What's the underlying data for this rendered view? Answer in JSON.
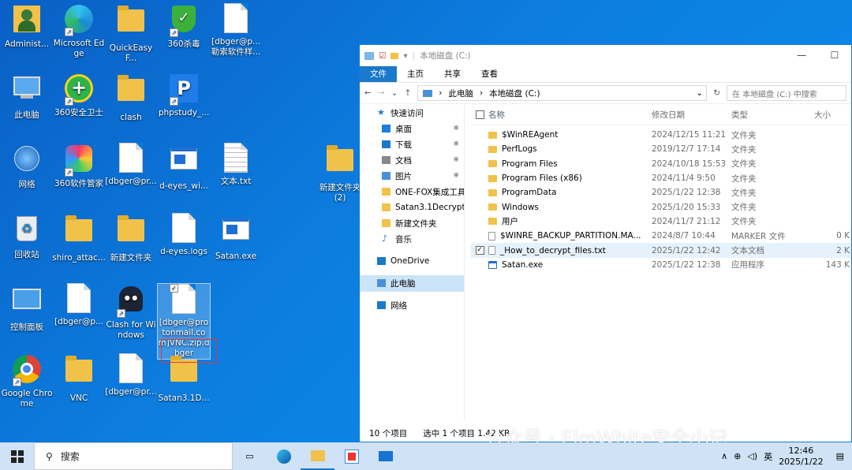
{
  "desktop": {
    "icons": [
      {
        "label": "Administ...",
        "kind": "user"
      },
      {
        "label": "Microsoft Edge",
        "kind": "edge"
      },
      {
        "label": "QuickEasyF...",
        "kind": "folder"
      },
      {
        "label": "360杀毒",
        "kind": "shield"
      },
      {
        "label": "[dbger@p... 勒索软件样...",
        "kind": "doc"
      },
      {
        "label": "此电脑",
        "kind": "pc"
      },
      {
        "label": "360安全卫士",
        "kind": "plus"
      },
      {
        "label": "clash",
        "kind": "folder"
      },
      {
        "label": "phpstudy_...",
        "kind": "php"
      },
      {
        "label": "网络",
        "kind": "network"
      },
      {
        "label": "360软件管家",
        "kind": "apps"
      },
      {
        "label": "[dbger@pr...",
        "kind": "doc"
      },
      {
        "label": "d-eyes_wi...",
        "kind": "exe"
      },
      {
        "label": "文本.txt",
        "kind": "txt"
      },
      {
        "label": "新建文件夹 (2)",
        "kind": "folder"
      },
      {
        "label": "回收站",
        "kind": "recycle"
      },
      {
        "label": "shiro_attac...",
        "kind": "folder"
      },
      {
        "label": "新建文件夹",
        "kind": "folder"
      },
      {
        "label": "d-eyes.logs",
        "kind": "doc"
      },
      {
        "label": "Satan.exe",
        "kind": "exe"
      },
      {
        "label": "控制面板",
        "kind": "control"
      },
      {
        "label": "[dbger@p...",
        "kind": "doc"
      },
      {
        "label": "Clash for Windows",
        "kind": "cat"
      },
      {
        "label": "[dbger@protonmail.com]VNC.zip.dbger",
        "kind": "doc"
      },
      {
        "label": "Google Chrome",
        "kind": "chrome"
      },
      {
        "label": "VNC",
        "kind": "folder"
      },
      {
        "label": "[dbger@pr...",
        "kind": "doc"
      },
      {
        "label": "Satan3.1D...",
        "kind": "folder"
      }
    ]
  },
  "explorer": {
    "title": "本地磁盘 (C:)",
    "ribbon": [
      "文件",
      "主页",
      "共享",
      "查看"
    ],
    "address": [
      "此电脑",
      "本地磁盘 (C:)"
    ],
    "search_placeholder": "在 本地磁盘 (C:) 中搜索",
    "nav": [
      {
        "label": "快速访问",
        "pin": false
      },
      {
        "label": "桌面",
        "pin": true
      },
      {
        "label": "下载",
        "pin": true
      },
      {
        "label": "文档",
        "pin": true
      },
      {
        "label": "图片",
        "pin": true
      },
      {
        "label": "ONE-FOX集成工具箱",
        "pin": false
      },
      {
        "label": "Satan3.1Decrypt",
        "pin": false
      },
      {
        "label": "新建文件夹",
        "pin": false
      },
      {
        "label": "音乐",
        "pin": false
      },
      {
        "label": "OneDrive",
        "pin": false
      },
      {
        "label": "此电脑",
        "pin": false
      },
      {
        "label": "网络",
        "pin": false
      }
    ],
    "columns": {
      "name": "名称",
      "date": "修改日期",
      "type": "类型",
      "size": "大小"
    },
    "files": [
      {
        "name": "$WinREAgent",
        "date": "2024/12/15 11:21",
        "type": "文件夹",
        "size": "",
        "icon": "folder"
      },
      {
        "name": "PerfLogs",
        "date": "2019/12/7 17:14",
        "type": "文件夹",
        "size": "",
        "icon": "folder"
      },
      {
        "name": "Program Files",
        "date": "2024/10/18 15:53",
        "type": "文件夹",
        "size": "",
        "icon": "folder"
      },
      {
        "name": "Program Files (x86)",
        "date": "2024/11/4 9:50",
        "type": "文件夹",
        "size": "",
        "icon": "folder"
      },
      {
        "name": "ProgramData",
        "date": "2025/1/22 12:38",
        "type": "文件夹",
        "size": "",
        "icon": "folder"
      },
      {
        "name": "Windows",
        "date": "2025/1/20 15:33",
        "type": "文件夹",
        "size": "",
        "icon": "folder"
      },
      {
        "name": "用户",
        "date": "2024/11/7 21:12",
        "type": "文件夹",
        "size": "",
        "icon": "folder"
      },
      {
        "name": "$WINRE_BACKUP_PARTITION.MA...",
        "date": "2024/8/7 10:44",
        "type": "MARKER 文件",
        "size": "0 K",
        "icon": "file"
      },
      {
        "name": "_How_to_decrypt_files.txt",
        "date": "2025/1/22 12:42",
        "type": "文本文档",
        "size": "2 K",
        "icon": "txt"
      },
      {
        "name": "Satan.exe",
        "date": "2025/1/22 12:38",
        "type": "应用程序",
        "size": "143 K",
        "icon": "exe"
      }
    ],
    "status": {
      "count": "10 个项目",
      "selected": "选中 1 个项目 1.42 KB"
    }
  },
  "taskbar": {
    "search": "搜索",
    "ime": "英",
    "time": "12:46",
    "date": "2025/1/22"
  },
  "watermark": "公众号・ElmWhite安全小记"
}
